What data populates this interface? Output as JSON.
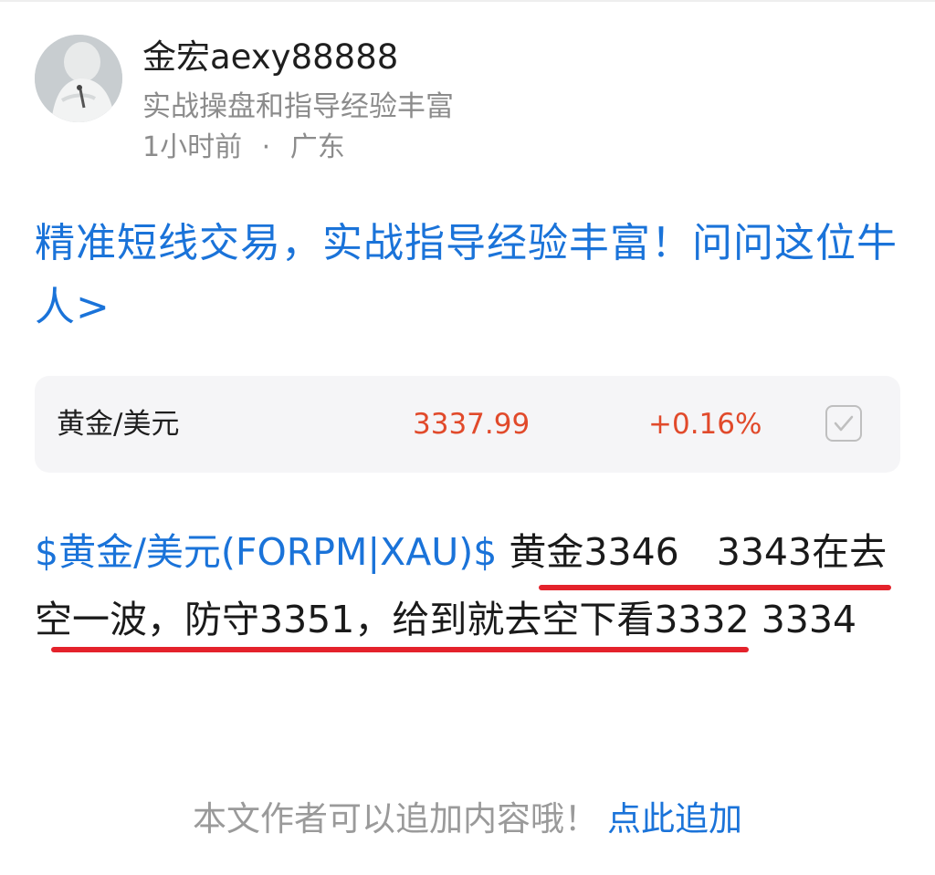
{
  "author": {
    "name": "金宏aexy88888",
    "bio": "实战操盘和指导经验丰富",
    "time": "1小时前",
    "separator": "·",
    "location": "广东"
  },
  "promo": {
    "text": "精准短线交易，实战指导经验丰富！问问这位牛人>"
  },
  "quote": {
    "name": "黄金/美元",
    "price": "3337.99",
    "change": "+0.16%",
    "price_color": "#e14a2b",
    "checkbox_icon": "checkbox-icon"
  },
  "post": {
    "stock_tag": "$黄金/美元(FORPM|XAU)$",
    "text": " 黄金3346　3343在去空一波，防守3351，给到就去空下看3332  3334",
    "highlight_color": "#e4222b"
  },
  "append": {
    "hint": "本文作者可以追加内容哦！",
    "link": "点此追加"
  },
  "colors": {
    "link_blue": "#1a73d9",
    "muted_gray": "#8c8c8c",
    "card_bg": "#f5f5f7"
  }
}
